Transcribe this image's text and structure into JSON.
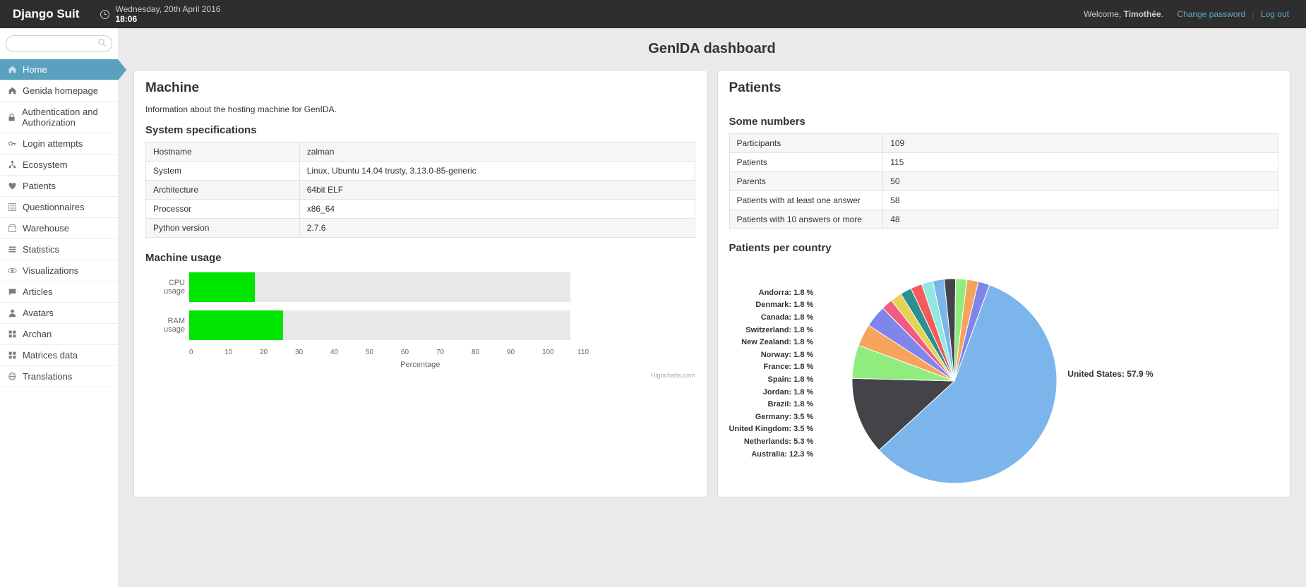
{
  "header": {
    "brand": "Django Suit",
    "date": "Wednesday, 20th April 2016",
    "time": "18:06",
    "welcome_prefix": "Welcome, ",
    "username": "Timothée",
    "change_password": "Change password",
    "logout": "Log out"
  },
  "sidebar": {
    "search_placeholder": "",
    "items": [
      {
        "label": "Home",
        "icon": "home"
      },
      {
        "label": "Genida homepage",
        "icon": "home"
      },
      {
        "label": "Authentication and Authorization",
        "icon": "lock"
      },
      {
        "label": "Login attempts",
        "icon": "key"
      },
      {
        "label": "Ecosystem",
        "icon": "tree"
      },
      {
        "label": "Patients",
        "icon": "heart"
      },
      {
        "label": "Questionnaires",
        "icon": "list"
      },
      {
        "label": "Warehouse",
        "icon": "box"
      },
      {
        "label": "Statistics",
        "icon": "bars"
      },
      {
        "label": "Visualizations",
        "icon": "eye"
      },
      {
        "label": "Articles",
        "icon": "chat"
      },
      {
        "label": "Avatars",
        "icon": "user"
      },
      {
        "label": "Archan",
        "icon": "grid"
      },
      {
        "label": "Matrices data",
        "icon": "grid"
      },
      {
        "label": "Translations",
        "icon": "globe"
      }
    ]
  },
  "page_title": "GenIDA dashboard",
  "machine": {
    "title": "Machine",
    "subtitle": "Information about the hosting machine for GenIDA.",
    "specs_title": "System specifications",
    "specs": [
      {
        "k": "Hostname",
        "v": "zalman"
      },
      {
        "k": "System",
        "v": "Linux, Ubuntu 14.04 trusty, 3.13.0-85-generic"
      },
      {
        "k": "Architecture",
        "v": "64bit ELF"
      },
      {
        "k": "Processor",
        "v": "x86_64"
      },
      {
        "k": "Python version",
        "v": "2.7.6"
      }
    ],
    "usage_title": "Machine usage",
    "axis_title": "Percentage",
    "credit": "Highcharts.com"
  },
  "patients": {
    "title": "Patients",
    "numbers_title": "Some numbers",
    "numbers": [
      {
        "k": "Participants",
        "v": "109"
      },
      {
        "k": "Patients",
        "v": "115"
      },
      {
        "k": "Parents",
        "v": "50"
      },
      {
        "k": "Patients with at least one answer",
        "v": "58"
      },
      {
        "k": "Patients with 10 answers or more",
        "v": "48"
      }
    ],
    "pie_title": "Patients per country"
  },
  "chart_data": [
    {
      "type": "bar",
      "orientation": "horizontal",
      "title": "Machine usage",
      "xlabel": "Percentage",
      "xlim": [
        0,
        110
      ],
      "categories": [
        "CPU usage",
        "RAM usage"
      ],
      "values": [
        19,
        27
      ],
      "color": "#00e600"
    },
    {
      "type": "pie",
      "title": "Patients per country",
      "series": [
        {
          "name": "United States",
          "value": 57.9,
          "color": "#7cb5ec"
        },
        {
          "name": "Australia",
          "value": 12.3,
          "color": "#434348"
        },
        {
          "name": "Netherlands",
          "value": 5.3,
          "color": "#90ed7d"
        },
        {
          "name": "United Kingdom",
          "value": 3.5,
          "color": "#f7a35c"
        },
        {
          "name": "Germany",
          "value": 3.5,
          "color": "#8085e9"
        },
        {
          "name": "Brazil",
          "value": 1.8,
          "color": "#f15c80"
        },
        {
          "name": "Jordan",
          "value": 1.8,
          "color": "#e4d354"
        },
        {
          "name": "Spain",
          "value": 1.8,
          "color": "#2b908f"
        },
        {
          "name": "France",
          "value": 1.8,
          "color": "#f45b5b"
        },
        {
          "name": "Norway",
          "value": 1.8,
          "color": "#91e8e1"
        },
        {
          "name": "New Zealand",
          "value": 1.8,
          "color": "#7cb5ec"
        },
        {
          "name": "Switzerland",
          "value": 1.8,
          "color": "#434348"
        },
        {
          "name": "Canada",
          "value": 1.8,
          "color": "#90ed7d"
        },
        {
          "name": "Denmark",
          "value": 1.8,
          "color": "#f7a35c"
        },
        {
          "name": "Andorra",
          "value": 1.8,
          "color": "#8085e9"
        }
      ]
    }
  ]
}
